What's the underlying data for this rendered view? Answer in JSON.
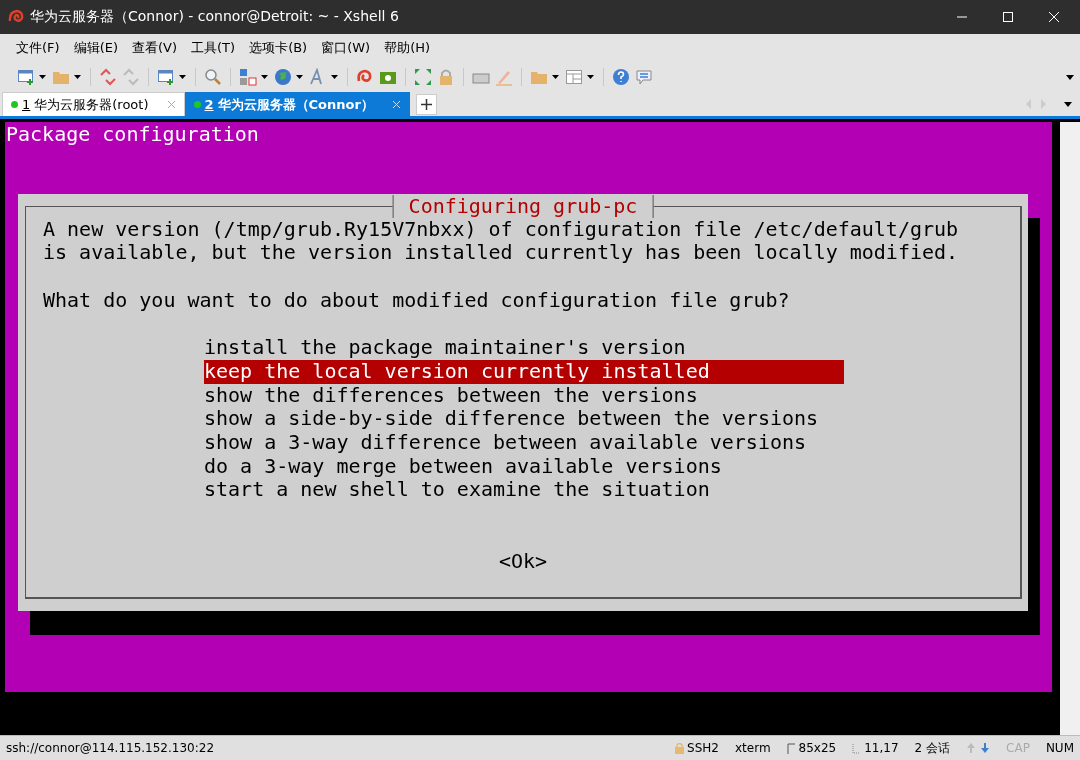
{
  "window": {
    "title": "华为云服务器（Connor)   - connor@Detroit: ~ - Xshell 6"
  },
  "menu": [
    "文件(F)",
    "编辑(E)",
    "查看(V)",
    "工具(T)",
    "选项卡(B)",
    "窗口(W)",
    "帮助(H)"
  ],
  "tabs": [
    {
      "number": "1",
      "label": "华为云服务器(root)",
      "selected": false
    },
    {
      "number": "2",
      "label": "华为云服务器（Connor）",
      "selected": true
    }
  ],
  "terminal": {
    "header": "Package configuration",
    "dialog": {
      "title": "Configuring grub-pc",
      "message": [
        "A new version (/tmp/grub.Ry15V7nbxx) of configuration file /etc/default/grub",
        "is available, but the version installed currently has been locally modified."
      ],
      "question": "What do you want to do about modified configuration file grub?",
      "options": [
        {
          "label": "install the package maintainer's version",
          "selected": false
        },
        {
          "label": "keep the local version currently installed",
          "selected": true
        },
        {
          "label": "show the differences between the versions",
          "selected": false
        },
        {
          "label": "show a side-by-side difference between the versions",
          "selected": false
        },
        {
          "label": "show a 3-way difference between available versions",
          "selected": false
        },
        {
          "label": "do a 3-way merge between available versions",
          "selected": false
        },
        {
          "label": "start a new shell to examine the situation",
          "selected": false
        }
      ],
      "button": "<Ok>"
    }
  },
  "status_bar": {
    "address": "ssh://connor@114.115.152.130:22",
    "items": [
      {
        "kind": "protocol",
        "label": "SSH2",
        "disabled": false
      },
      {
        "kind": "plain",
        "label": "xterm",
        "disabled": false
      },
      {
        "kind": "size",
        "label": "85x25",
        "disabled": false
      },
      {
        "kind": "cursor",
        "label": "11,17",
        "disabled": false
      },
      {
        "kind": "plain",
        "label": "2 会话",
        "disabled": false
      },
      {
        "kind": "arrows"
      },
      {
        "kind": "plain",
        "label": "CAP",
        "disabled": true
      },
      {
        "kind": "plain",
        "label": "NUM",
        "disabled": false
      }
    ]
  }
}
